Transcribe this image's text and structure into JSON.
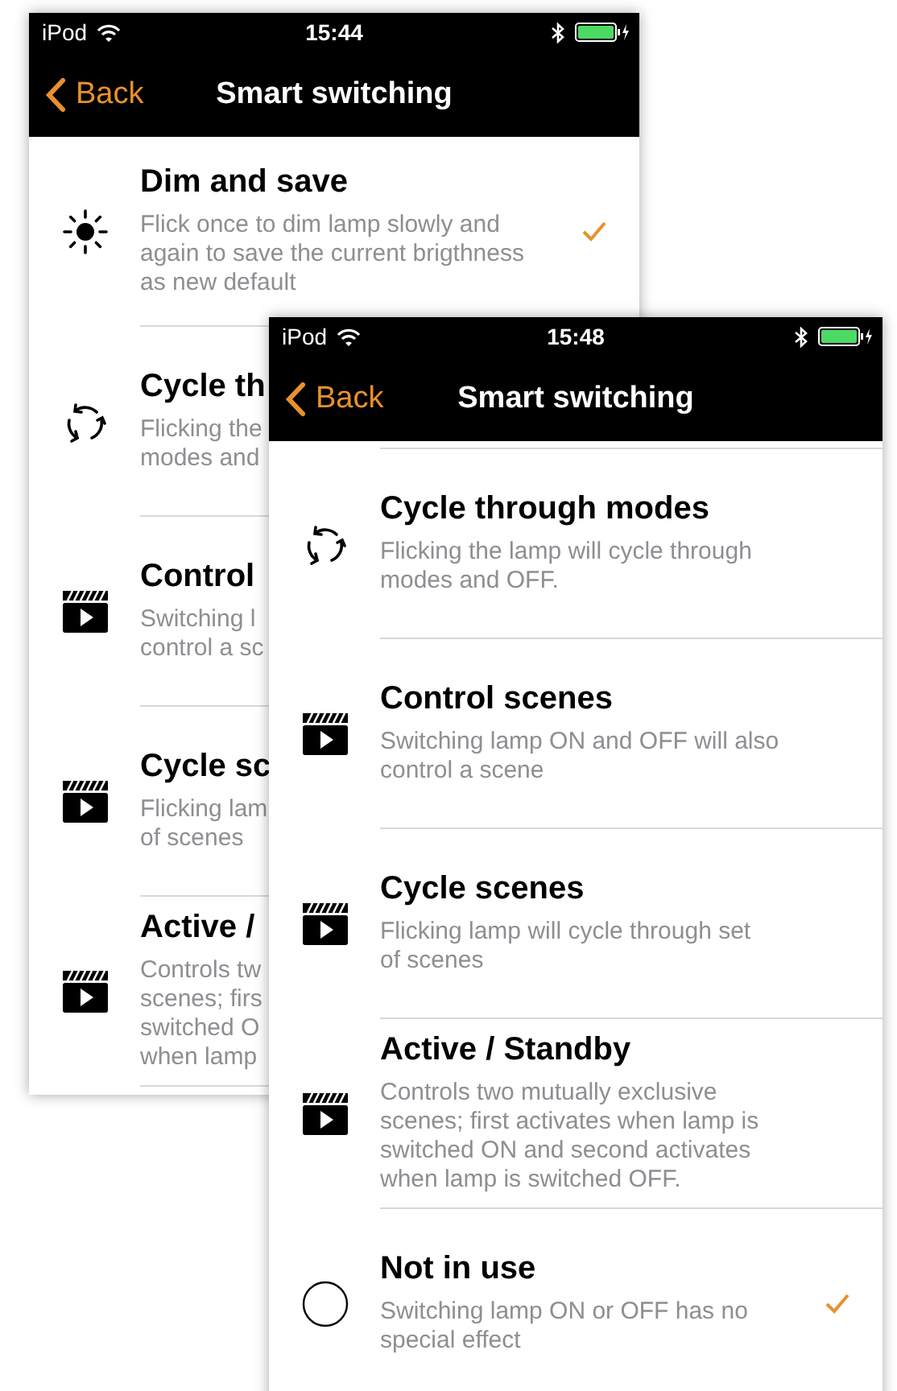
{
  "screens": [
    {
      "status_bar": {
        "carrier": "iPod",
        "time": "15:44"
      },
      "nav": {
        "back": "Back",
        "title": "Smart switching"
      },
      "items": [
        {
          "kind": "sun",
          "title": "Dim and save",
          "lines": [
            "Flick once to dim lamp slowly and",
            "again to save the current brigthness",
            "as new default"
          ],
          "checked": true
        },
        {
          "kind": "cycle",
          "title": "Cycle th",
          "lines": [
            "Flicking the",
            "modes and"
          ],
          "checked": false
        },
        {
          "kind": "scene",
          "title": "Control",
          "lines": [
            "Switching l",
            "control a sc"
          ],
          "checked": false
        },
        {
          "kind": "scene",
          "title": "Cycle sc",
          "lines": [
            "Flicking lam",
            "of scenes"
          ],
          "checked": false
        },
        {
          "kind": "scene",
          "title": "Active /",
          "lines": [
            "Controls tw",
            "scenes; firs",
            "switched O",
            "when lamp"
          ],
          "checked": false
        }
      ]
    },
    {
      "status_bar": {
        "carrier": "iPod",
        "time": "15:48"
      },
      "nav": {
        "back": "Back",
        "title": "Smart switching"
      },
      "items": [
        {
          "kind": "cycle",
          "title": "Cycle through modes",
          "lines": [
            "Flicking the lamp will cycle through",
            "modes and OFF."
          ],
          "checked": false
        },
        {
          "kind": "scene",
          "title": "Control scenes",
          "lines": [
            "Switching lamp ON and OFF will also",
            "control a scene"
          ],
          "checked": false
        },
        {
          "kind": "scene",
          "title": "Cycle scenes",
          "lines": [
            "Flicking lamp will cycle through set",
            "of scenes"
          ],
          "checked": false
        },
        {
          "kind": "scene",
          "title": "Active / Standby",
          "lines": [
            "Controls two mutually exclusive",
            "scenes; first activates when lamp is",
            "switched ON and second activates",
            "when lamp is switched OFF."
          ],
          "checked": false
        },
        {
          "kind": "circle",
          "title": "Not in use",
          "lines": [
            "Switching lamp ON or OFF has no",
            "special effect"
          ],
          "checked": true
        }
      ]
    }
  ]
}
